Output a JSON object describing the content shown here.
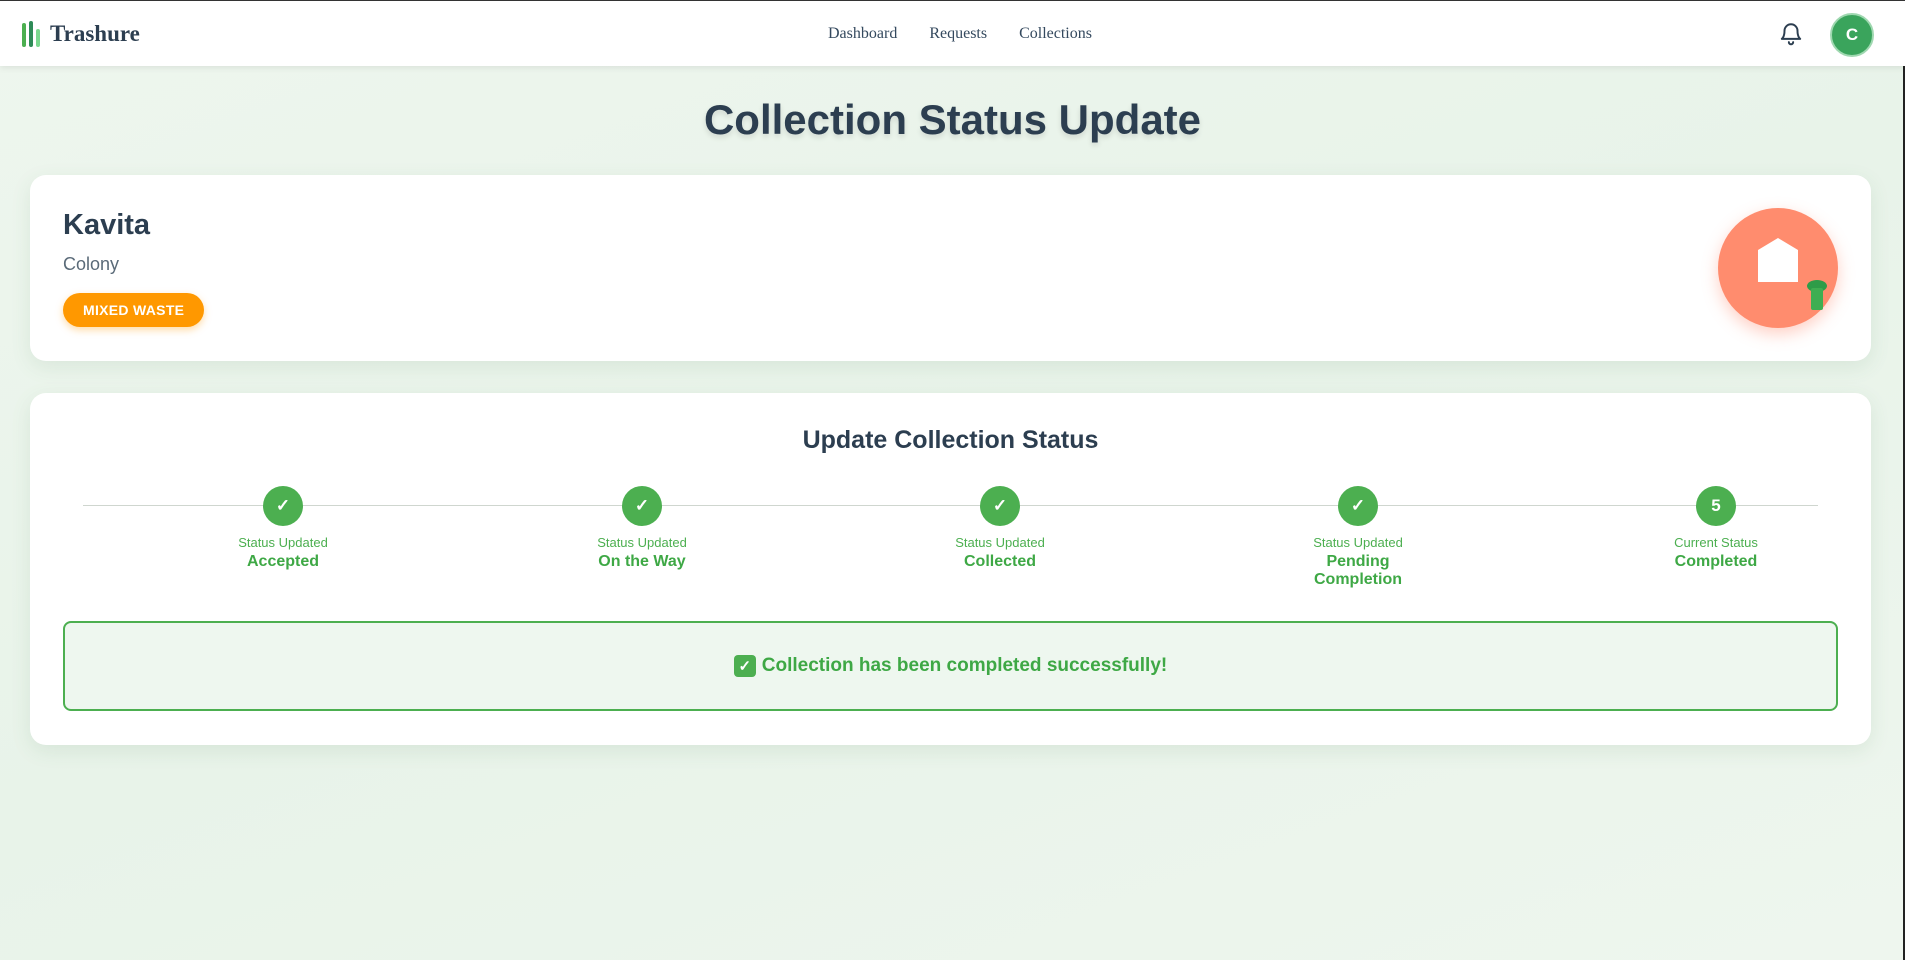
{
  "app": {
    "name": "Trashure"
  },
  "nav": {
    "links": [
      "Dashboard",
      "Requests",
      "Collections"
    ]
  },
  "user": {
    "initial": "C"
  },
  "page": {
    "title": "Collection Status Update"
  },
  "request": {
    "name": "Kavita",
    "area": "Colony",
    "waste_type": "MIXED WASTE"
  },
  "status": {
    "title": "Update Collection Status",
    "steps": [
      {
        "caption": "Status Updated",
        "label": "Accepted",
        "marker": "✓"
      },
      {
        "caption": "Status Updated",
        "label": "On the Way",
        "marker": "✓"
      },
      {
        "caption": "Status Updated",
        "label": "Collected",
        "marker": "✓"
      },
      {
        "caption": "Status Updated",
        "label": "Pending Completion",
        "marker": "✓"
      },
      {
        "caption": "Current Status",
        "label": "Completed",
        "marker": "5"
      }
    ],
    "message": "Collection has been completed successfully!"
  },
  "colors": {
    "accent": "#4caf50",
    "badge": "#ff9800",
    "house_bg": "#ff8c6e"
  },
  "icons": {
    "brand": "logo-bars-icon",
    "bell": "bell-icon",
    "house": "house-icon",
    "bin": "bin-icon",
    "check": "check-mark-icon"
  }
}
